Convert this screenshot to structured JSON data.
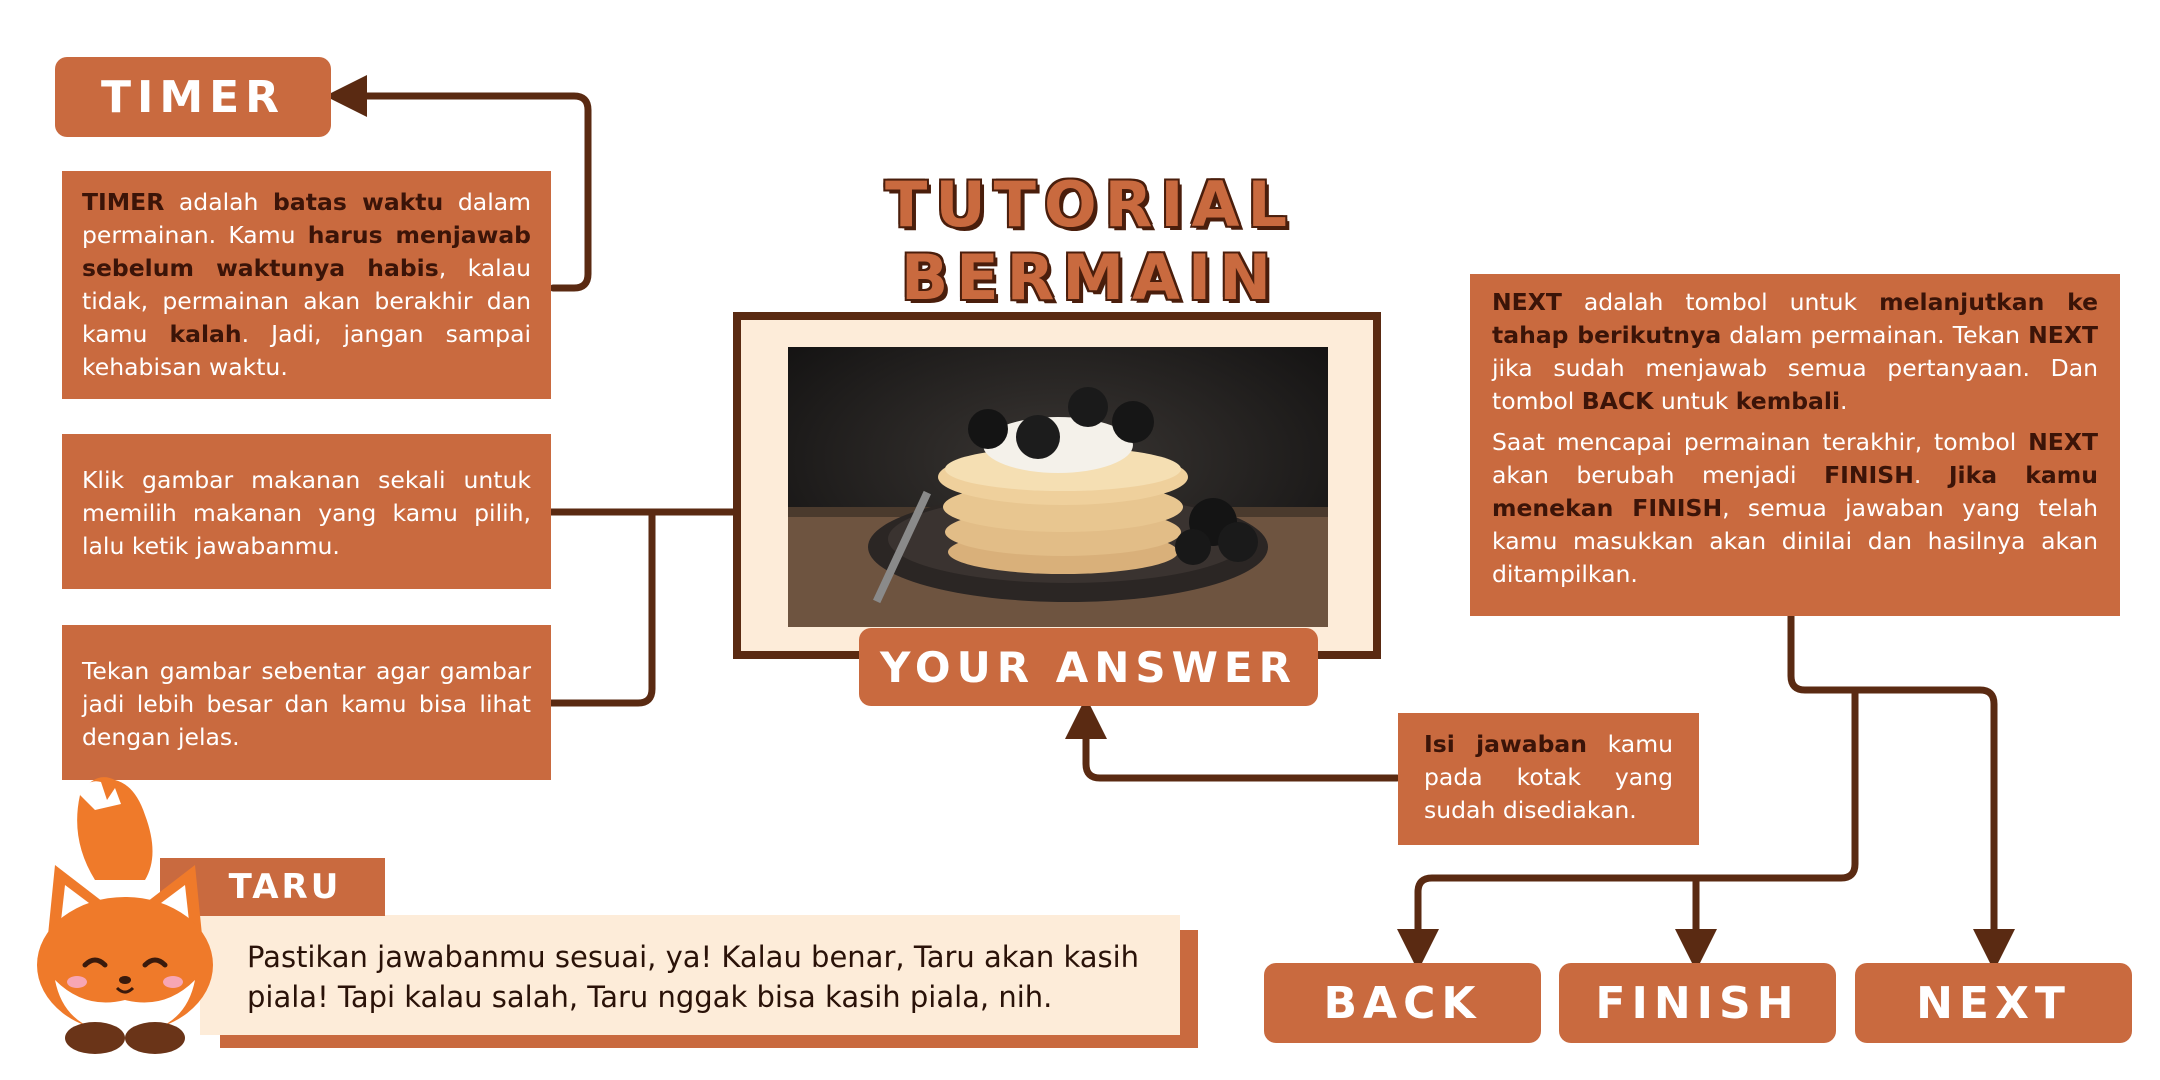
{
  "title": "TUTORIAL BERMAIN",
  "timer_button": "TIMER",
  "timer_info": {
    "k1": "TIMER",
    "t1": " adalah ",
    "k2": "batas waktu",
    "t2": " dalam permainan. Kamu ",
    "k3": "harus menjawab sebelum waktunya habis",
    "t3": ", kalau tidak, permainan akan berakhir dan kamu ",
    "k4": "kalah",
    "t4": ". Jadi, jangan sampai kehabisan waktu."
  },
  "click_info": "Klik gambar makanan sekali untuk memilih makanan yang kamu pilih, lalu ketik jawabanmu.",
  "hold_info": "Tekan gambar sebentar agar gambar jadi lebih besar dan kamu bisa lihat dengan jelas.",
  "answer_button": "YOUR ANSWER",
  "answer_info": {
    "k1": "Isi jawaban",
    "t1": " kamu pada kotak yang sudah disediakan."
  },
  "next_info": {
    "p1": {
      "k1": "NEXT",
      "t1": " adalah tombol untuk ",
      "k2": "melanjutkan ke tahap berikutnya",
      "t2": " dalam permainan. Tekan ",
      "k3": "NEXT",
      "t3": " jika sudah menjawab semua pertanyaan. Dan tombol ",
      "k4": "BACK",
      "t4": " untuk ",
      "k5": "kembali",
      "t5": "."
    },
    "p2": {
      "t1": "Saat mencapai permainan terakhir, tombol ",
      "k1": "NEXT",
      "t2": " akan berubah menjadi ",
      "k2": "FINISH",
      "t3": ". ",
      "k3": "Jika kamu menekan FINISH",
      "t4": ", semua jawaban yang telah kamu masukkan akan dinilai dan hasilnya akan ditampilkan."
    }
  },
  "mascot_name": "TARU",
  "mascot_message": "Pastikan jawabanmu sesuai, ya! Kalau benar, Taru akan kasih piala! Tapi kalau salah, Taru nggak bisa kasih piala, nih.",
  "buttons": {
    "back": "BACK",
    "finish": "FINISH",
    "next": "NEXT"
  },
  "colors": {
    "accent": "#c96a3f",
    "dark": "#5a2a12",
    "cream": "#fdecd9",
    "highlight_text": "#3b1408"
  }
}
